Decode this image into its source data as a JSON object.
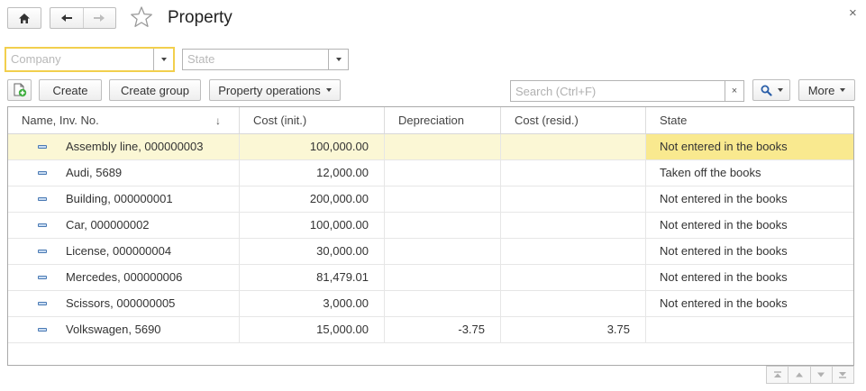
{
  "header": {
    "title": "Property",
    "close_symbol": "×",
    "icons": [
      "home-icon",
      "back-arrow-icon",
      "forward-arrow-icon",
      "star-icon",
      "close-icon"
    ]
  },
  "filters": {
    "company": {
      "placeholder": "Company",
      "value": ""
    },
    "state": {
      "placeholder": "State",
      "value": ""
    }
  },
  "toolbar": {
    "create_label": "Create",
    "create_group_label": "Create group",
    "property_operations_label": "Property operations",
    "search_placeholder": "Search (Ctrl+F)",
    "clear_symbol": "×",
    "more_label": "More"
  },
  "table": {
    "columns": [
      "Name, Inv. No.",
      "Cost (init.)",
      "Depreciation",
      "Cost (resid.)",
      "State"
    ],
    "sort_indicator": "↓",
    "rows": [
      {
        "name": "Assembly line, 000000003",
        "cost_init": "100,000.00",
        "depreciation": "",
        "cost_resid": "",
        "state": "Not entered in the books"
      },
      {
        "name": "Audi, 5689",
        "cost_init": "12,000.00",
        "depreciation": "",
        "cost_resid": "",
        "state": "Taken off the books"
      },
      {
        "name": "Building, 000000001",
        "cost_init": "200,000.00",
        "depreciation": "",
        "cost_resid": "",
        "state": "Not entered in the books"
      },
      {
        "name": "Car, 000000002",
        "cost_init": "100,000.00",
        "depreciation": "",
        "cost_resid": "",
        "state": "Not entered in the books"
      },
      {
        "name": "License, 000000004",
        "cost_init": "30,000.00",
        "depreciation": "",
        "cost_resid": "",
        "state": "Not entered in the books"
      },
      {
        "name": "Mercedes, 000000006",
        "cost_init": "81,479.01",
        "depreciation": "",
        "cost_resid": "",
        "state": "Not entered in the books"
      },
      {
        "name": "Scissors, 000000005",
        "cost_init": "3,000.00",
        "depreciation": "",
        "cost_resid": "",
        "state": "Not entered in the books"
      },
      {
        "name": "Volkswagen, 5690",
        "cost_init": "15,000.00",
        "depreciation": "-3.75",
        "cost_resid": "3.75",
        "state": ""
      }
    ]
  },
  "colors": {
    "focus_border": "#f2cf4d",
    "selected_row": "#fbf7d5",
    "selected_cell": "#f9e98f",
    "row_icon": "#4a7ab4"
  }
}
